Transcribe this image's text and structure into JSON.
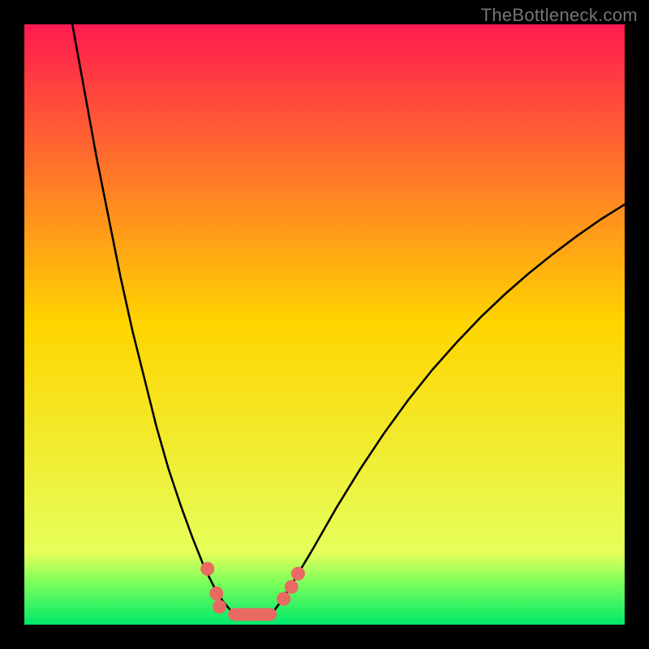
{
  "watermark": "TheBottleneck.com",
  "chart_data": {
    "type": "line",
    "title": "",
    "xlabel": "",
    "ylabel": "",
    "xlim": [
      0,
      100
    ],
    "ylim": [
      0,
      100
    ],
    "gradient_stops": [
      {
        "offset": 0,
        "color": "#ff1a50"
      },
      {
        "offset": 0.5,
        "color": "#ffd500"
      },
      {
        "offset": 0.88,
        "color": "#e6ff5a"
      },
      {
        "offset": 0.93,
        "color": "#7bff5a"
      },
      {
        "offset": 1.0,
        "color": "#00e86b"
      }
    ],
    "series": [
      {
        "name": "left-branch",
        "stroke": "#000000",
        "x": [
          8,
          10,
          12,
          14,
          16,
          18,
          20,
          22,
          24,
          26,
          28,
          30,
          31.5,
          33,
          34.5
        ],
        "y": [
          100,
          89,
          78,
          68,
          58,
          49,
          41,
          33,
          26,
          20,
          14.5,
          9.5,
          6.5,
          4,
          2.2
        ]
      },
      {
        "name": "right-branch",
        "stroke": "#000000",
        "x": [
          41.5,
          43,
          45,
          48,
          52,
          56,
          60,
          64,
          68,
          72,
          76,
          80,
          84,
          88,
          92,
          96,
          100
        ],
        "y": [
          2.2,
          4.2,
          7.5,
          12.5,
          19.5,
          26,
          32,
          37.5,
          42.5,
          47,
          51.2,
          55,
          58.5,
          61.7,
          64.7,
          67.5,
          70
        ]
      },
      {
        "name": "valley-floor",
        "stroke": "#000000",
        "x": [
          34.5,
          36,
          38,
          40,
          41.5
        ],
        "y": [
          2.2,
          1.4,
          1.1,
          1.4,
          2.2
        ]
      }
    ],
    "markers": [
      {
        "name": "dot",
        "shape": "circle",
        "cx": 30.5,
        "cy": 9.3,
        "r": 1.15,
        "fill": "#e96a62"
      },
      {
        "name": "dot",
        "shape": "circle",
        "cx": 32.0,
        "cy": 5.2,
        "r": 1.15,
        "fill": "#e96a62"
      },
      {
        "name": "dot",
        "shape": "circle",
        "cx": 32.5,
        "cy": 3.0,
        "r": 1.15,
        "fill": "#e96a62"
      },
      {
        "name": "dot",
        "shape": "circle",
        "cx": 43.2,
        "cy": 4.3,
        "r": 1.15,
        "fill": "#e96a62"
      },
      {
        "name": "dot",
        "shape": "circle",
        "cx": 44.5,
        "cy": 6.3,
        "r": 1.15,
        "fill": "#e96a62"
      },
      {
        "name": "dot",
        "shape": "circle",
        "cx": 45.6,
        "cy": 8.5,
        "r": 1.15,
        "fill": "#e96a62"
      },
      {
        "name": "capsule",
        "shape": "capsule",
        "x1": 35.0,
        "y1": 1.7,
        "x2": 41.0,
        "y2": 1.7,
        "r": 1.05,
        "fill": "#e96a62"
      }
    ]
  }
}
